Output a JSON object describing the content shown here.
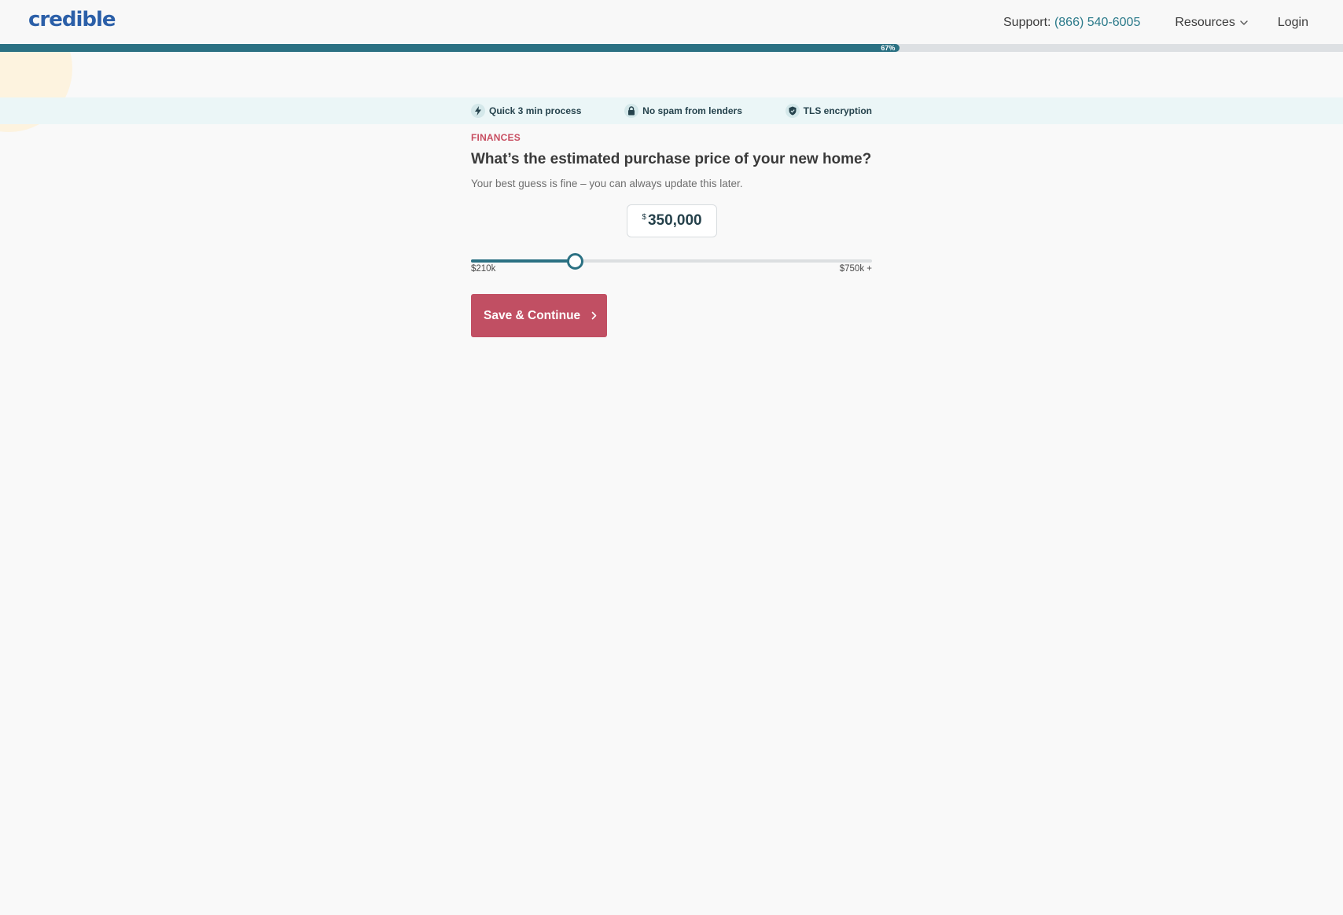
{
  "header": {
    "logo": "credible",
    "support_label": "Support:",
    "support_phone": "(866) 540-6005",
    "resources_label": "Resources",
    "login_label": "Login"
  },
  "progress": {
    "percent": 67,
    "label": "67%"
  },
  "trust": {
    "items": [
      {
        "label": "Quick 3 min process",
        "icon": "lightning-icon"
      },
      {
        "label": "No spam from lenders",
        "icon": "lock-icon"
      },
      {
        "label": "TLS encryption",
        "icon": "shield-icon"
      }
    ]
  },
  "step": {
    "eyebrow": "FINANCES",
    "question": "What’s the estimated purchase price of your new home?",
    "hint": "Your best guess is fine – you can always update this later."
  },
  "price": {
    "currency": "$",
    "amount": "350,000",
    "value": 350000
  },
  "slider": {
    "min": 210000,
    "max": 750000,
    "min_label": "$210k",
    "max_label": "$750k +",
    "fraction": 0.258
  },
  "cta": {
    "label": "Save & Continue"
  },
  "colors": {
    "brand": "#2b5fa8",
    "accent": "#2b7183",
    "cta": "#c14f63",
    "eyebrow": "#c84e61"
  }
}
